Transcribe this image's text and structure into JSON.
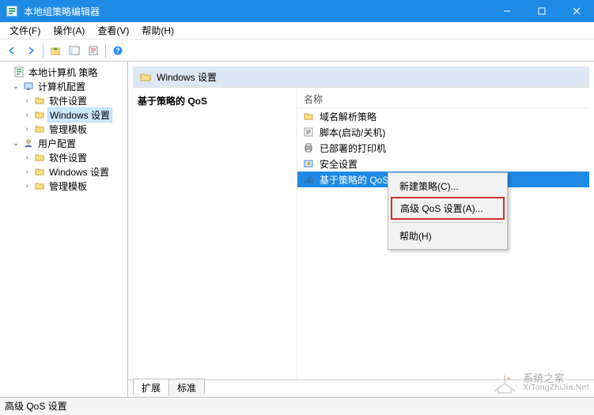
{
  "window": {
    "title": "本地组策略编辑器"
  },
  "menu": {
    "file": "文件(F)",
    "action": "操作(A)",
    "view": "查看(V)",
    "help": "帮助(H)"
  },
  "tree": {
    "root": "本地计算机 策略",
    "computer": "计算机配置",
    "c_software": "软件设置",
    "c_windows": "Windows 设置",
    "c_templates": "管理模板",
    "user": "用户配置",
    "u_software": "软件设置",
    "u_windows": "Windows 设置",
    "u_templates": "管理模板"
  },
  "content": {
    "header": "Windows 设置",
    "heading": "基于策略的 QoS",
    "col_name": "名称",
    "items": {
      "dns": "域名解析策略",
      "scripts": "脚本(启动/关机)",
      "printers": "已部署的打印机",
      "security": "安全设置",
      "qos": "基于策略的 QoS"
    }
  },
  "context_menu": {
    "new_policy": "新建策略(C)...",
    "advanced": "高级 QoS 设置(A)...",
    "help": "帮助(H)"
  },
  "tabs": {
    "extended": "扩展",
    "standard": "标准"
  },
  "status": {
    "text": "高级 QoS 设置"
  },
  "watermark": {
    "name": "系统之家",
    "url": "XiTongZhiJia.Net"
  }
}
